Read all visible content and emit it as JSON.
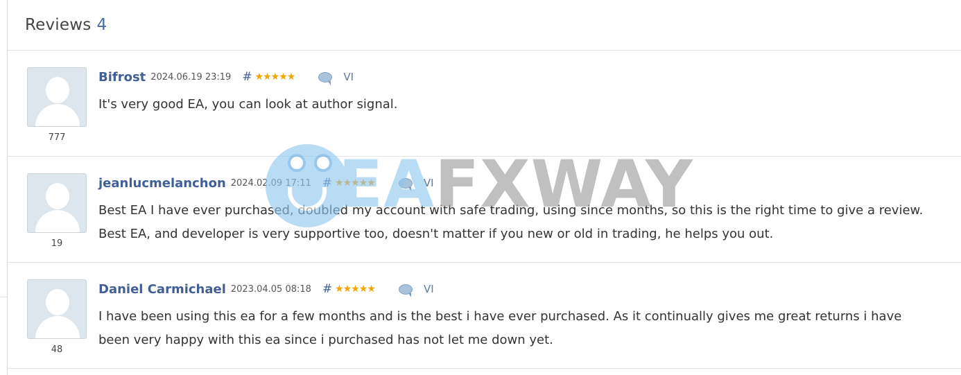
{
  "header": {
    "title": "Reviews",
    "count": "4"
  },
  "reviews": [
    {
      "author": "Bifrost",
      "date": "2024.06.19 23:19",
      "hash": "#",
      "stars": "★★★★★",
      "lang": "VI",
      "avatar_number": "777",
      "text": "It's very good EA, you can look at author signal."
    },
    {
      "author": "jeanlucmelanchon",
      "date": "2024.02.09 17:11",
      "hash": "#",
      "stars": "★★★★★",
      "lang": "VI",
      "avatar_number": "19",
      "text": "Best EA I have ever purchased, doubled my account with safe trading, using since months, so this is the right time to give a review. Best EA, and developer is very supportive too, doesn't matter if you new or old in trading, he helps you out."
    },
    {
      "author": "Daniel Carmichael",
      "date": "2023.04.05 08:18",
      "hash": "#",
      "stars": "★★★★★",
      "lang": "VI",
      "avatar_number": "48",
      "text": "I have been using this ea for a few months and is the best i have ever purchased. As it continually gives me great returns i have been very happy with this ea since i purchased has not let me down yet."
    }
  ],
  "watermark": {
    "part1": "EA",
    "part2": "FXWAY"
  },
  "colors": {
    "accent": "#3f5f96",
    "star": "#f2a400",
    "border": "#e2e2e2"
  }
}
